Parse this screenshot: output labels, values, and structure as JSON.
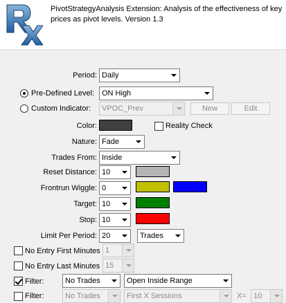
{
  "header": {
    "logo_text": "Rx",
    "title": "PivotStrategyAnalysis Extension: Analysis of the effectiveness of key prices as pivot levels. Version 1.3"
  },
  "period": {
    "label": "Period:",
    "value": "Daily"
  },
  "predefined_level": {
    "label": "Pre-Defined Level:",
    "value": "ON High",
    "selected": true
  },
  "custom_indicator": {
    "label": "Custom Indicator:",
    "value": "VPOC_Prev",
    "selected": false,
    "new_label": "New",
    "edit_label": "Edit"
  },
  "color": {
    "label": "Color:",
    "swatch": "#404040"
  },
  "reality_check": {
    "label": "Reality Check",
    "checked": false
  },
  "nature": {
    "label": "Nature:",
    "value": "Fade"
  },
  "trades_from": {
    "label": "Trades From:",
    "value": "Inside"
  },
  "reset_distance": {
    "label": "Reset Distance:",
    "value": "10",
    "swatch": "#b4b4b4"
  },
  "frontrun_wiggle": {
    "label": "Frontrun Wiggle:",
    "value": "0",
    "swatch1": "#c0c000",
    "swatch2": "#0000ff"
  },
  "target": {
    "label": "Target:",
    "value": "10",
    "swatch": "#008000"
  },
  "stop": {
    "label": "Stop:",
    "value": "10",
    "swatch": "#ff0000"
  },
  "limit_per_period": {
    "label": "Limit Per Period:",
    "value": "20",
    "unit": "Trades"
  },
  "no_entry_first": {
    "label": "No Entry First Minutes",
    "value": "1",
    "checked": false
  },
  "no_entry_last": {
    "label": "No Entry Last Minutes",
    "value": "15",
    "checked": false
  },
  "filter1": {
    "label": "Filter:",
    "checked": true,
    "value1": "No Trades",
    "value2": "Open Inside Range"
  },
  "filter2": {
    "label": "Filter:",
    "checked": false,
    "value1": "No Trades",
    "value2": "First X Sessions",
    "x_label": "X=",
    "x_value": "10"
  }
}
